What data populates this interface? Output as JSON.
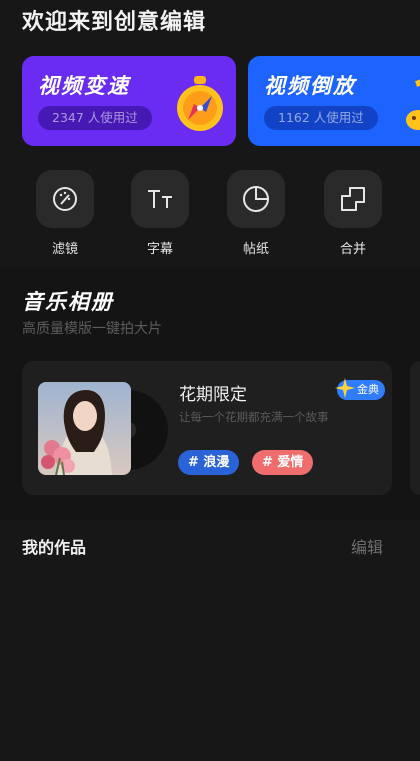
{
  "header": {
    "title": "欢迎来到创意编辑"
  },
  "features": [
    {
      "title": "视频变速",
      "count": "2347 人使用过",
      "icon": "stopwatch-icon"
    },
    {
      "title": "视频倒放",
      "count": "1162 人使用过",
      "icon": "music-note-icon"
    }
  ],
  "tools": [
    {
      "label": "滤镜",
      "icon": "magic-wand-icon"
    },
    {
      "label": "字幕",
      "icon": "text-size-icon"
    },
    {
      "label": "帖纸",
      "icon": "sticker-icon"
    },
    {
      "label": "合并",
      "icon": "merge-icon"
    }
  ],
  "music_album": {
    "title": "音乐相册",
    "subtitle": "高质量模版一键拍大片",
    "card": {
      "name": "花期限定",
      "description": "让每一个花期都充满一个故事",
      "badge": "金典",
      "tags": [
        "# 浪漫",
        "# 爱情"
      ]
    }
  },
  "my_works": {
    "title": "我的作品",
    "edit_label": "编辑"
  },
  "colors": {
    "background": "#171717",
    "speed_card": "#6a2cf2",
    "reverse_card": "#1d63ff",
    "tag_romance": "#2a63d8",
    "tag_love": "#f06d6d",
    "badge": "#2f7cff"
  }
}
